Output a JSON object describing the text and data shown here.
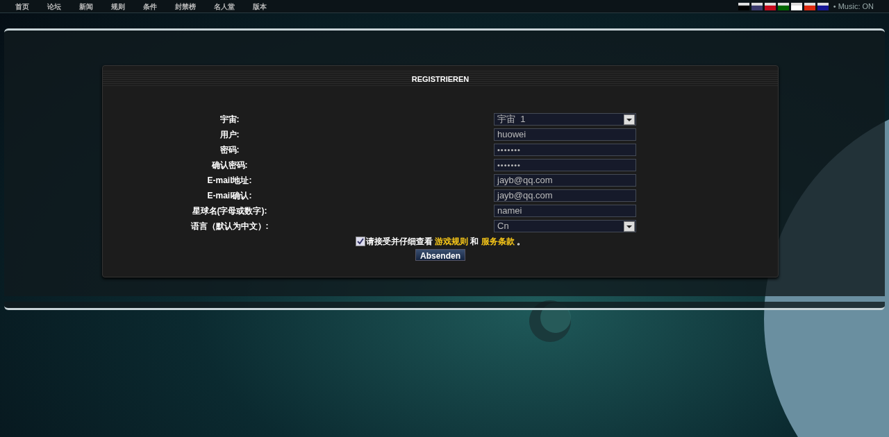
{
  "nav": [
    "首页",
    "论坛",
    "新闻",
    "规则",
    "条件",
    "封禁榜",
    "名人堂",
    "版本"
  ],
  "flags": [
    {
      "color": "#000000"
    },
    {
      "color": "#3c3b6e"
    },
    {
      "color": "#c60b1e"
    },
    {
      "color": "#006600"
    },
    {
      "color": "#ffffff"
    },
    {
      "color": "#de2910"
    },
    {
      "color": "#171796"
    }
  ],
  "music": "• Music: ON",
  "form": {
    "title": "REGISTRIEREN",
    "fields": [
      {
        "label": "宇宙:",
        "kind": "select",
        "value": "宇宙  1"
      },
      {
        "label": "用户:",
        "kind": "text",
        "value": "huowei"
      },
      {
        "label": "密码:",
        "kind": "password",
        "value": "•••••••"
      },
      {
        "label": "确认密码:",
        "kind": "password",
        "value": "•••••••"
      },
      {
        "label": "E-mail地址:",
        "kind": "text",
        "value": "jayb@qq.com"
      },
      {
        "label": "E-mail确认:",
        "kind": "text",
        "value": "jayb@qq.com"
      },
      {
        "label": "星球名(字母或数字):",
        "kind": "text",
        "value": "namei"
      },
      {
        "label": "语言（默认为中文）:",
        "kind": "select",
        "value": "Cn"
      }
    ],
    "agree": {
      "checked": true,
      "text": "请接受并仔细查看",
      "link1": "游戏规则",
      "between": "和",
      "link2": "服务条款",
      "end": "。"
    },
    "submit": "Absenden"
  }
}
